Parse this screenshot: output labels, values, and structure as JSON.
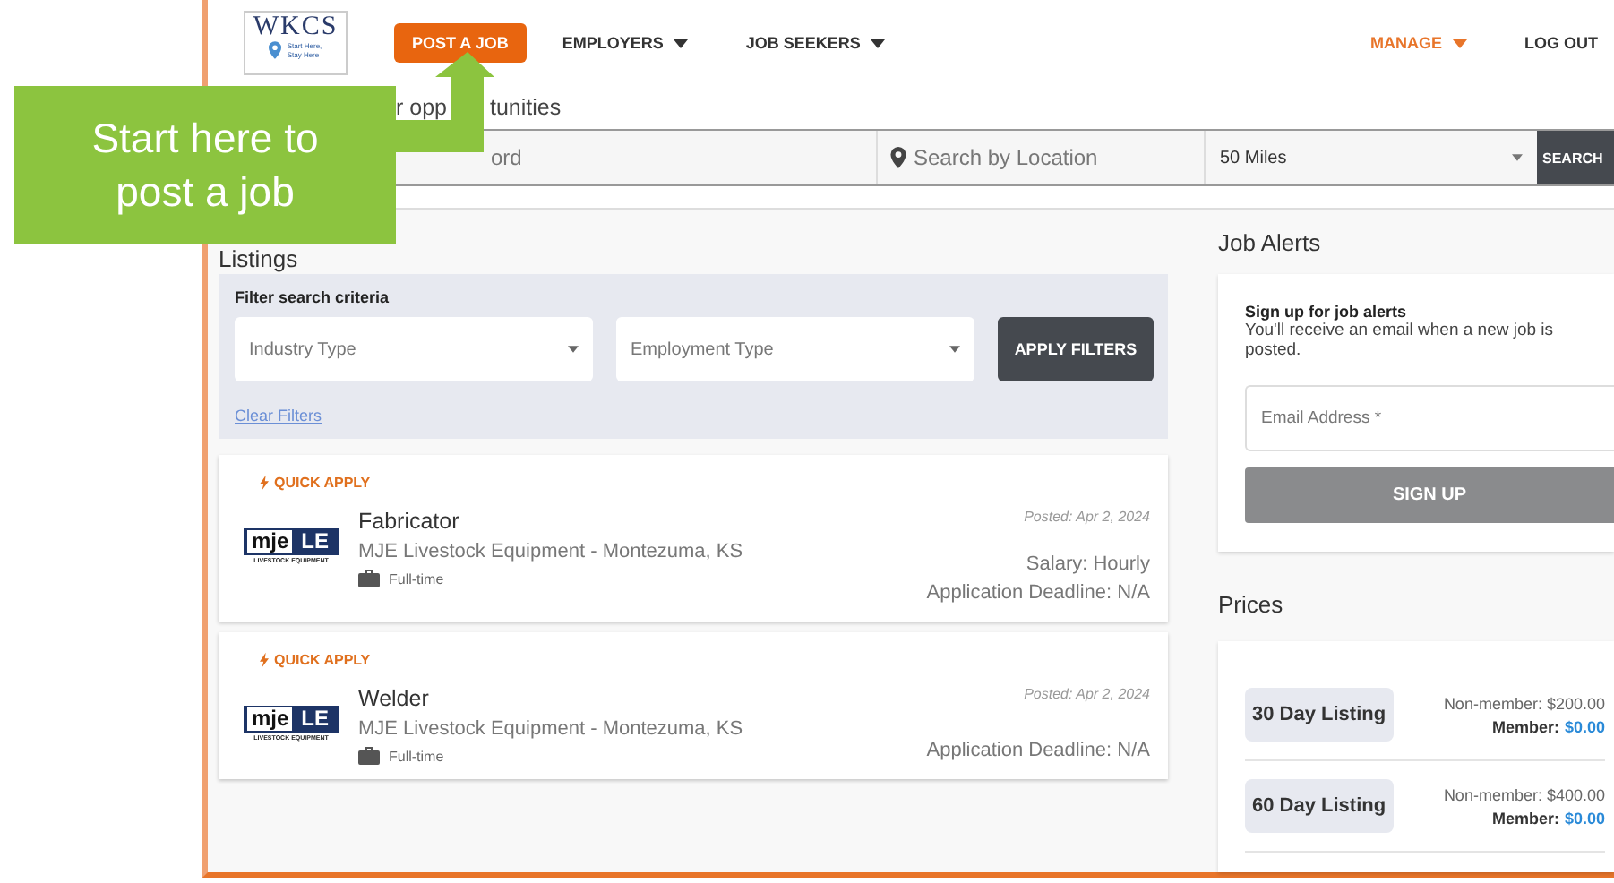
{
  "header": {
    "logo": {
      "title": "WKCS",
      "tagline_1": "Start Here,",
      "tagline_2": "Stay Here"
    },
    "nav": [
      {
        "label": "POST A JOB",
        "kind": "button",
        "selected": false,
        "dropdown": false
      },
      {
        "label": "EMPLOYERS",
        "kind": "menu",
        "selected": false,
        "dropdown": true
      },
      {
        "label": "JOB SEEKERS",
        "kind": "menu",
        "selected": false,
        "dropdown": true
      },
      {
        "label": "MANAGE",
        "kind": "menu",
        "selected": true,
        "dropdown": true
      },
      {
        "label": "LOG OUT",
        "kind": "menu",
        "selected": false,
        "dropdown": false
      }
    ]
  },
  "heading_parts": [
    "r opp",
    "tunities"
  ],
  "search": {
    "keyword_placeholder": "ord",
    "location_placeholder": "Search by Location",
    "distance": "50 Miles",
    "button": "SEARCH"
  },
  "listings": {
    "title": "Listings",
    "filters": {
      "title": "Filter search criteria",
      "industry_placeholder": "Industry Type",
      "employment_placeholder": "Employment Type",
      "apply": "APPLY FILTERS",
      "clear": "Clear Filters"
    },
    "jobs": [
      {
        "badge": "QUICK APPLY",
        "title": "Fabricator",
        "company": "MJE Livestock Equipment - Montezuma, KS",
        "type": "Full-time",
        "posted": "Posted: Apr 2, 2024",
        "salary": "Salary: Hourly",
        "deadline": "Application Deadline: N/A",
        "logo": {
          "mark": "mje",
          "suffix": "LE",
          "caption": "LIVESTOCK EQUIPMENT"
        }
      },
      {
        "badge": "QUICK APPLY",
        "title": "Welder",
        "company": "MJE Livestock Equipment - Montezuma, KS",
        "type": "Full-time",
        "posted": "Posted: Apr 2, 2024",
        "deadline": "Application Deadline: N/A",
        "logo": {
          "mark": "mje",
          "suffix": "LE",
          "caption": "LIVESTOCK EQUIPMENT"
        }
      }
    ]
  },
  "job_alerts": {
    "title": "Job Alerts",
    "subtitle": "Sign up for job alerts",
    "text": "You'll receive an email when a new job is posted.",
    "email_placeholder": "Email Address *",
    "button": "SIGN UP"
  },
  "prices": {
    "title": "Prices",
    "items": [
      {
        "name": "30 Day Listing",
        "non_member": "Non-member: $200.00",
        "member_label": "Member:",
        "member_price": "$0.00"
      },
      {
        "name": "60 Day Listing",
        "non_member": "Non-member: $400.00",
        "member_label": "Member:",
        "member_price": "$0.00"
      }
    ]
  },
  "callout": {
    "text": "Start here to post a job"
  }
}
